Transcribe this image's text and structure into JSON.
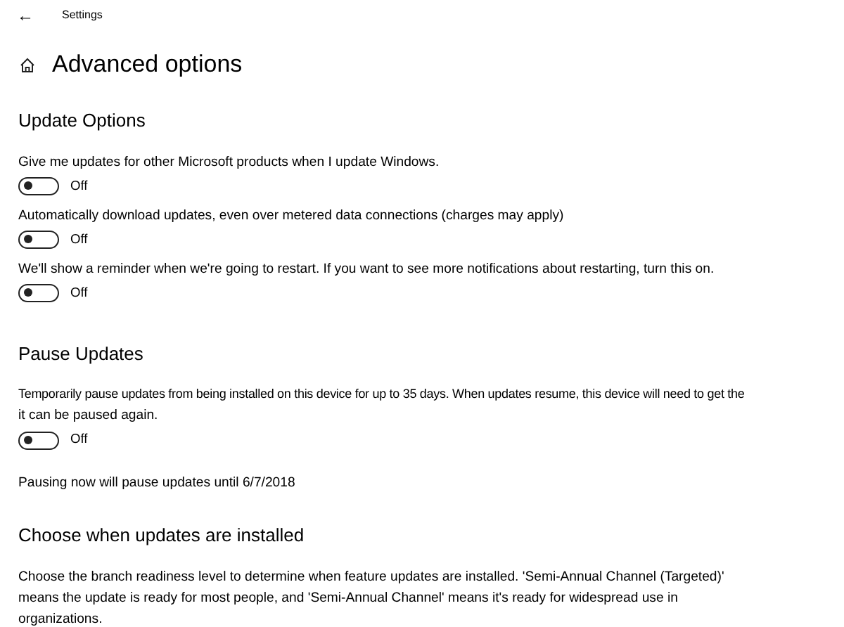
{
  "window": {
    "title": "Settings",
    "back": "←"
  },
  "page_title": "Advanced options",
  "sections": [
    {
      "heading": "Update Options",
      "items": [
        {
          "kind": "toggle",
          "lines": [
            "Give me updates for other Microsoft products when I update Windows."
          ],
          "on": false,
          "state_label": "Off"
        },
        {
          "kind": "toggle",
          "lines": [
            "Automatically download updates, even over metered data connections (charges may apply)"
          ],
          "on": false,
          "state_label": "Off"
        },
        {
          "kind": "toggle",
          "lines": [
            "We'll show a reminder when we're going to restart. If you want to see more notifications about restarting, turn this on."
          ],
          "on": false,
          "state_label": "Off"
        }
      ]
    },
    {
      "heading": "Pause Updates",
      "items": [
        {
          "kind": "toggle",
          "lines": [
            "Temporarily pause updates from being installed on this device for up to 35 days. When updates resume, this device will need to get the",
            "it can be paused again."
          ],
          "on": false,
          "state_label": "Off"
        },
        {
          "kind": "text",
          "lines": [
            "Pausing now will pause updates until 6/7/2018"
          ]
        }
      ]
    },
    {
      "heading": "Choose when updates are installed",
      "items": [
        {
          "kind": "text",
          "lines": [
            "Choose the branch readiness level to determine when feature updates are installed. 'Semi-Annual Channel (Targeted)' means the update is ready for most people, and 'Semi-Annual Channel' means it's ready for widespread use in organizations."
          ]
        }
      ]
    }
  ]
}
